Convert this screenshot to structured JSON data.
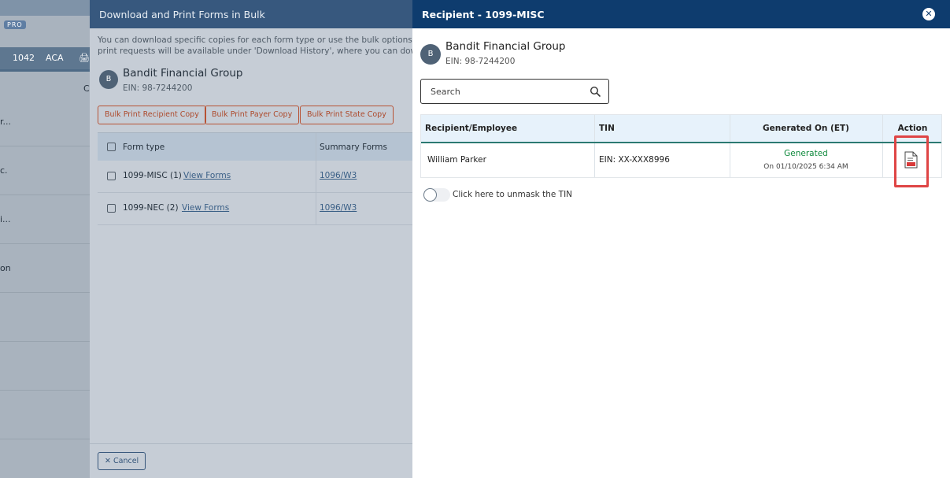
{
  "background_app": {
    "badge": "PRO",
    "nav": [
      "1042",
      "ACA"
    ],
    "nav_cut": "C",
    "rows": [
      "r...",
      "c.",
      "i...",
      "on"
    ]
  },
  "bulk_modal": {
    "title": "Download and Print Forms in Bulk",
    "description_line1": "You can download specific copies for each form type or use the bulk options to do",
    "description_line2": "print requests will be available under 'Download History', where you can downloa",
    "avatar": "B",
    "company": "Bandit Financial Group",
    "ein": "EIN: 98-7244200",
    "buttons": [
      "Bulk Print Recipient Copy",
      "Bulk Print Payer Copy",
      "Bulk Print State Copy"
    ],
    "table": {
      "headers": [
        "Form type",
        "Summary Forms"
      ],
      "rows": [
        {
          "form": "1099-MISC (1)",
          "link": "View Forms",
          "summary": "1096/W3"
        },
        {
          "form": "1099-NEC (2)",
          "link": "View Forms",
          "summary": "1096/W3"
        }
      ]
    },
    "cancel_label": "Cancel"
  },
  "panel": {
    "title": "Recipient - 1099-MISC",
    "avatar": "B",
    "company": "Bandit Financial Group",
    "ein": "EIN: 98-7244200",
    "search_placeholder": "Search",
    "headers": [
      "Recipient/Employee",
      "TIN",
      "Generated On (ET)",
      "Action"
    ],
    "rows": [
      {
        "name": "William Parker",
        "tin": "EIN: XX-XXX8996",
        "status": "Generated",
        "date": "On 01/10/2025 6:34 AM",
        "action_icon": "pdf-icon"
      }
    ],
    "unmask_label": "Click here to unmask the TIN",
    "colors": {
      "header": "#0e3c6e",
      "status": "#118a3e",
      "highlight": "#df4545"
    }
  }
}
